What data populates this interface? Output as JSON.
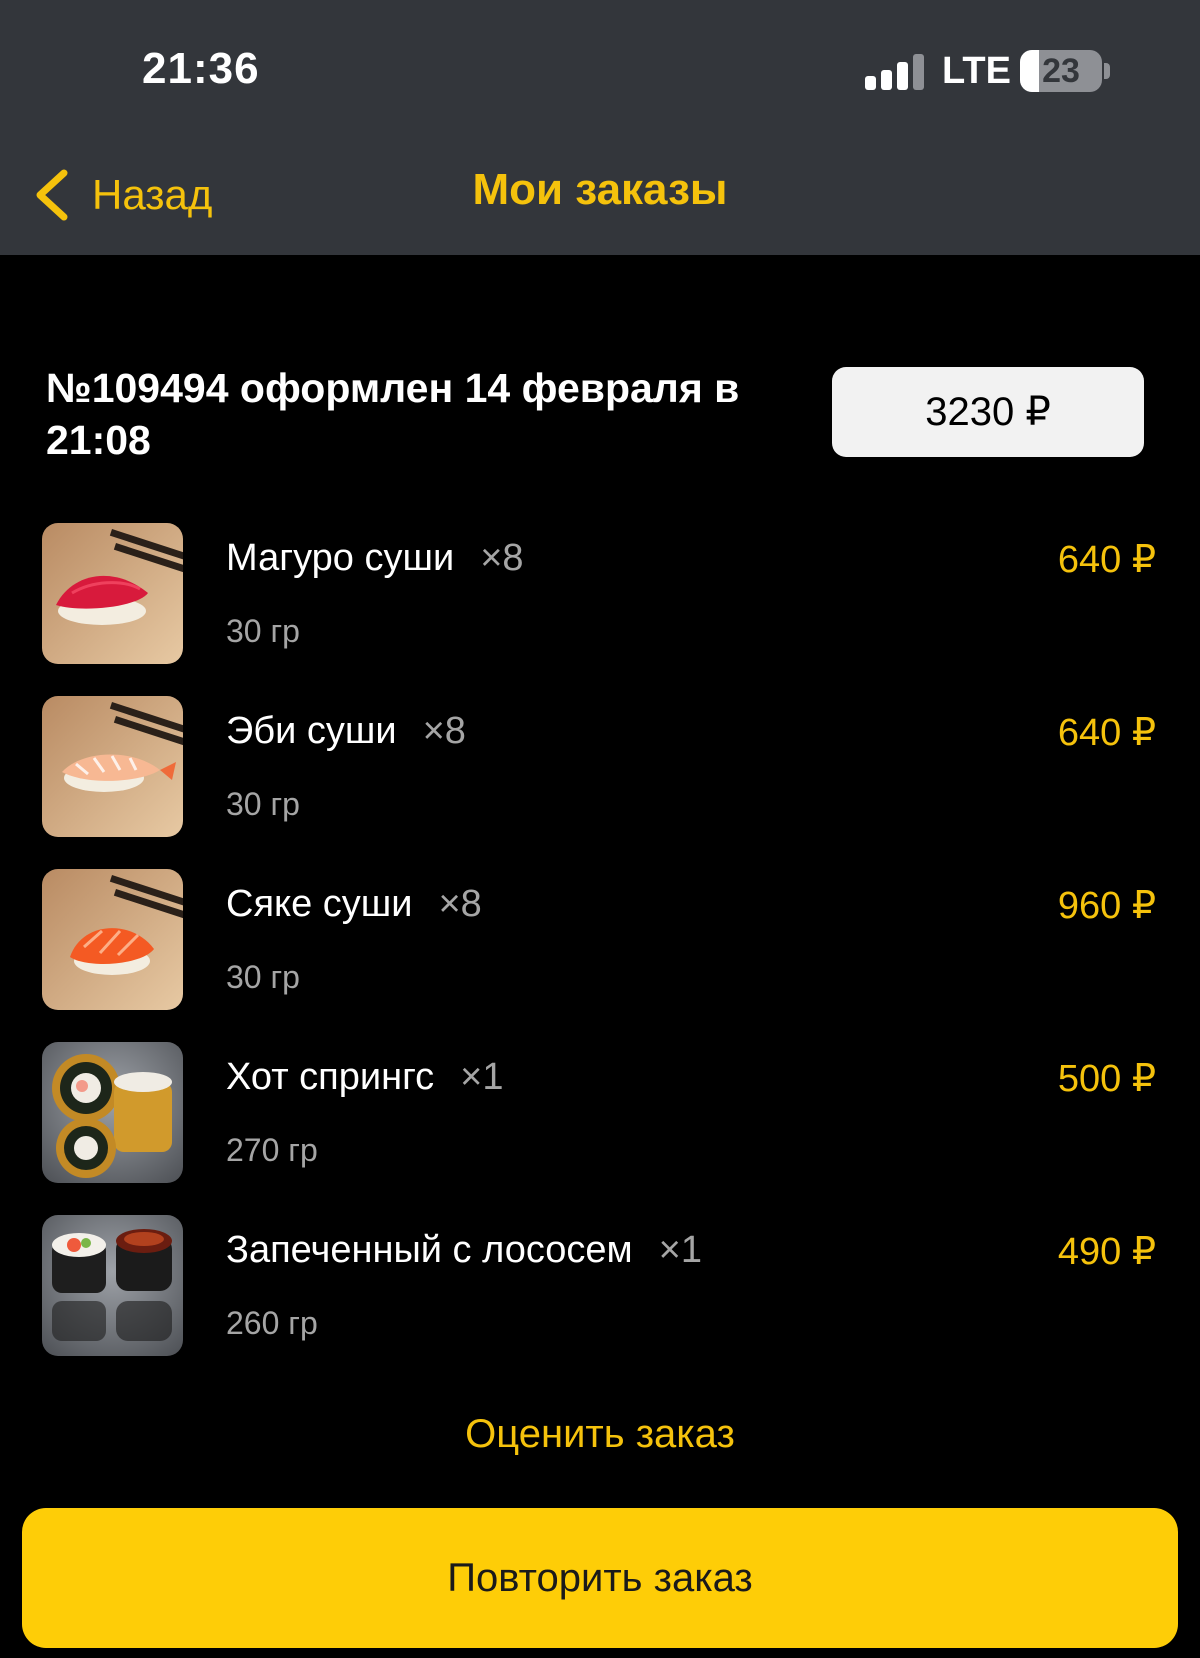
{
  "status_bar": {
    "time": "21:36",
    "network": "LTE",
    "battery": "23",
    "battery_level": 0.23
  },
  "nav": {
    "back_label": "Назад",
    "title": "Мои заказы"
  },
  "order": {
    "title": "№109494 оформлен 14 февраля в 21:08",
    "total": "3230 ₽",
    "items": [
      {
        "name": "Магуро суши",
        "qty": "×8",
        "weight": "30 гр",
        "price": "640 ₽"
      },
      {
        "name": "Эби суши",
        "qty": "×8",
        "weight": "30 гр",
        "price": "640 ₽"
      },
      {
        "name": "Сяке суши",
        "qty": "×8",
        "weight": "30 гр",
        "price": "960 ₽"
      },
      {
        "name": "Хот спрингс",
        "qty": "×1",
        "weight": "270 гр",
        "price": "500 ₽"
      },
      {
        "name": "Запеченный с лососем",
        "qty": "×1",
        "weight": "260 гр",
        "price": "490 ₽"
      }
    ]
  },
  "actions": {
    "rate_label": "Оценить заказ",
    "repeat_label": "Повторить заказ"
  },
  "colors": {
    "accent": "#f5c20c",
    "button": "#fecd07",
    "header_bg": "#33363b",
    "background": "#000000"
  }
}
